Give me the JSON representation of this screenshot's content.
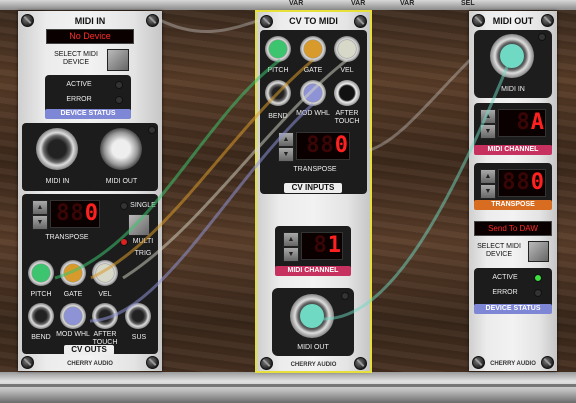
{
  "top_rail": {
    "labels": [
      "VAR",
      "VAR",
      "VAR",
      "SEL"
    ]
  },
  "midi_in": {
    "title": "MIDI IN",
    "device": "No Device",
    "select_label": "SELECT MIDI DEVICE",
    "active_label": "ACTIVE",
    "error_label": "ERROR",
    "status_tag": "DEVICE STATUS",
    "midi_in_label": "MIDI IN",
    "midi_out_label": "MIDI OUT",
    "transpose_value": "0",
    "transpose_label": "TRANSPOSE",
    "single_label": "SINGLE",
    "multi_label": "MULTI",
    "trig_label": "TRIG",
    "pitch": "PITCH",
    "gate": "GATE",
    "vel": "VEL",
    "bend": "BEND",
    "mod_whl": "MOD WHL",
    "after_touch": "AFTER TOUCH",
    "sus": "SUS",
    "cv_outs_tag": "CV OUTS",
    "brand": "CHERRY AUDIO"
  },
  "cv_to_midi": {
    "title": "CV TO MIDI",
    "pitch": "PITCH",
    "gate": "GATE",
    "vel": "VEL",
    "bend": "BEND",
    "mod_whl": "MOD WHL",
    "after_touch": "AFTER TOUCH",
    "transpose_value": "0",
    "transpose_label": "TRANSPOSE",
    "cv_inputs_tag": "CV INPUTS",
    "midi_channel_value": "1",
    "midi_channel_tag": "MIDI CHANNEL",
    "midi_out_label": "MIDI OUT",
    "brand": "CHERRY AUDIO"
  },
  "midi_out": {
    "title": "MIDI OUT",
    "midi_in_label": "MIDI IN",
    "midi_channel_value": "A",
    "midi_channel_tag": "MIDI CHANNEL",
    "transpose_value": "0",
    "transpose_tag": "TRANSPOSE",
    "device": "Send To DAW",
    "select_label": "SELECT MIDI DEVICE",
    "active_label": "ACTIVE",
    "error_label": "ERROR",
    "status_tag": "DEVICE STATUS",
    "brand": "CHERRY AUDIO"
  },
  "colors": {
    "display_red": "#ff2a2a",
    "selection_outline": "#e8e03a",
    "tag_blue": "#7e86d6",
    "tag_pink": "#c7315f",
    "tag_orange": "#d86d22",
    "jack_green": "#3cc46e",
    "jack_orange": "#d89a2a",
    "jack_cyan": "#6fd9c3",
    "jack_violet": "#8e93d6"
  }
}
